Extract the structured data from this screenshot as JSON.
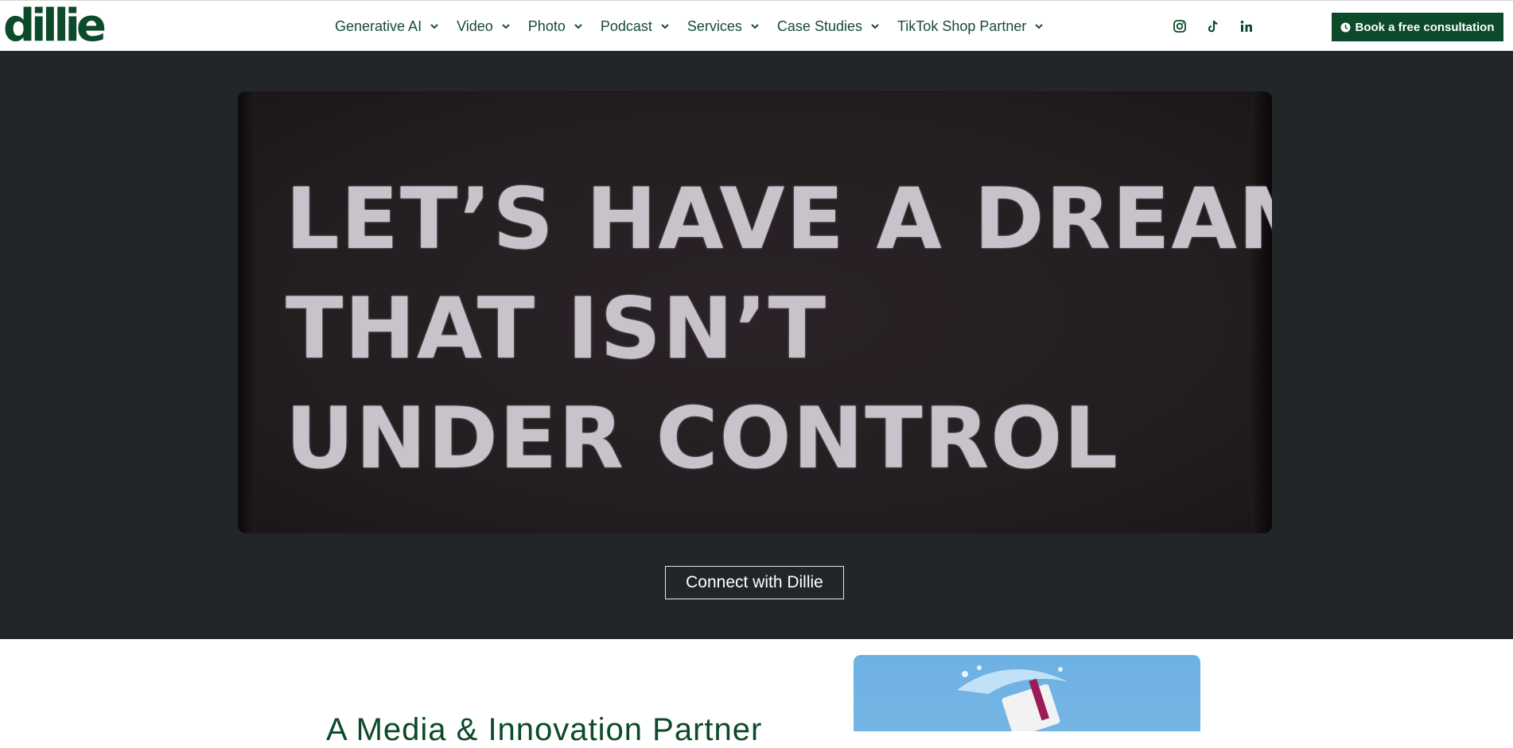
{
  "brand": {
    "logo_text": "dillie",
    "color": "#0b4a2a"
  },
  "nav": {
    "items": [
      {
        "label": "Generative AI",
        "has_dropdown": true
      },
      {
        "label": "Video",
        "has_dropdown": true
      },
      {
        "label": "Photo",
        "has_dropdown": true
      },
      {
        "label": "Podcast",
        "has_dropdown": true
      },
      {
        "label": "Services",
        "has_dropdown": true
      },
      {
        "label": "Case Studies",
        "has_dropdown": true
      },
      {
        "label": "TikTok Shop Partner",
        "has_dropdown": true
      }
    ]
  },
  "social": {
    "icons": [
      "instagram-icon",
      "tiktok-icon",
      "linkedin-icon"
    ]
  },
  "cta": {
    "label": "Book a free consultation",
    "icon": "clock-icon"
  },
  "hero": {
    "background": "#232629",
    "video_lines": [
      "LET’S HAVE A DREAM",
      "THAT ISN’T",
      "UNDER CONTROL"
    ],
    "connect_label": "Connect with Dillie"
  },
  "section": {
    "heading": "A Media & Innovation Partner"
  }
}
